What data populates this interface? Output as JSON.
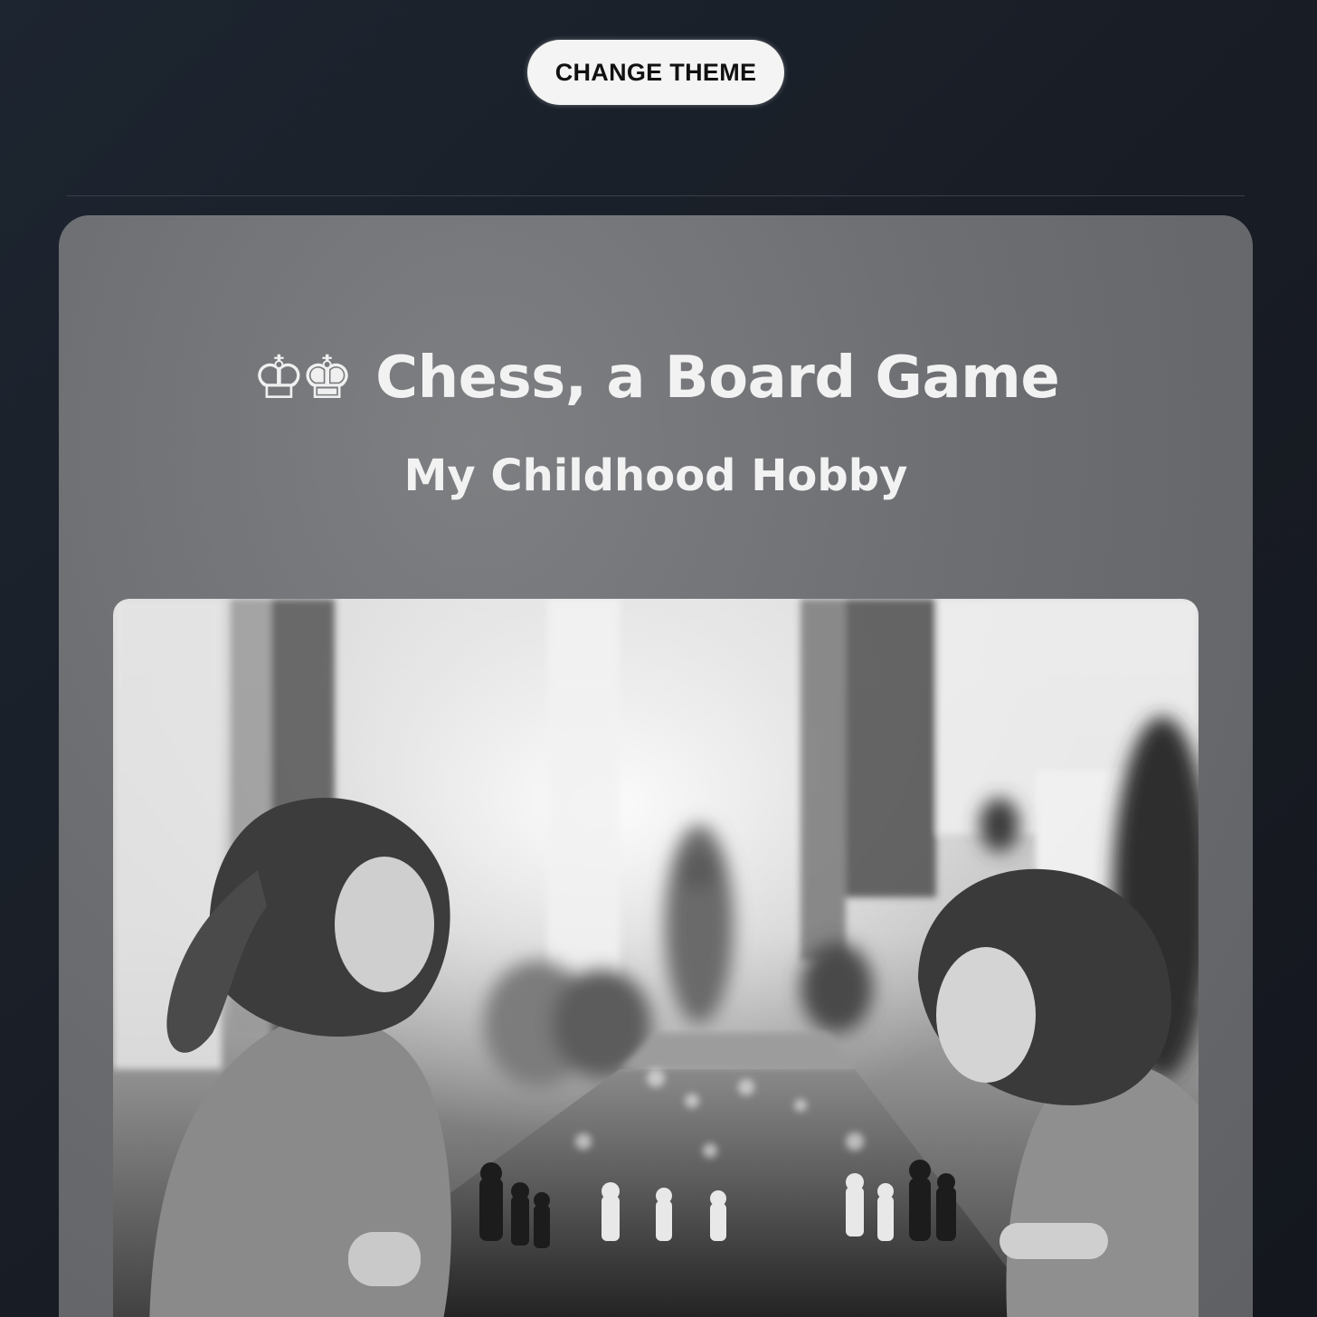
{
  "toolbar": {
    "theme_button_label": "CHANGE THEME"
  },
  "card": {
    "title_icons": "♔♚",
    "title": "Chess, a Board Game",
    "subtitle": "My Childhood Hobby",
    "photo_icon": "chess-tournament-photo"
  },
  "colors": {
    "page_background": "#181c24",
    "card_background": "#6c6e72",
    "button_background": "#f4f4f4",
    "title_text": "#f2f2f2"
  }
}
